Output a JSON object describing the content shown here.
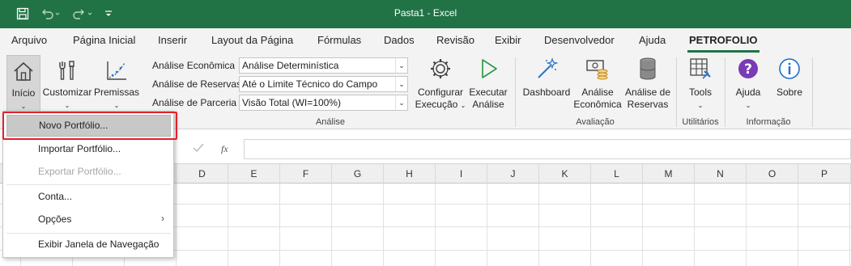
{
  "window": {
    "title": "Pasta1  -  Excel"
  },
  "quick_access": {
    "save_icon": "save-icon",
    "undo_icon": "undo-icon",
    "redo_icon": "redo-icon",
    "customize_icon": "customize-qat-icon"
  },
  "tabs": [
    {
      "label": "Arquivo"
    },
    {
      "label": "Página Inicial"
    },
    {
      "label": "Inserir"
    },
    {
      "label": "Layout da Página"
    },
    {
      "label": "Fórmulas"
    },
    {
      "label": "Dados"
    },
    {
      "label": "Revisão"
    },
    {
      "label": "Exibir"
    },
    {
      "label": "Desenvolvedor"
    },
    {
      "label": "Ajuda"
    },
    {
      "label": "PETROFOLIO"
    }
  ],
  "ribbon": {
    "inicio": {
      "label": "Início"
    },
    "customizar": {
      "label": "Customizar"
    },
    "premissas": {
      "label": "Premissas"
    },
    "fields": {
      "economica_label": "Análise Econômica",
      "economica_value": "Análise Determinística",
      "reservas_label": "Análise de Reservas",
      "reservas_value": "Até o Limite Técnico do Campo",
      "parceria_label": "Análise de Parceria",
      "parceria_value": "Visão Total (WI=100%)"
    },
    "configurar": {
      "line1": "Configurar",
      "line2": "Execução"
    },
    "executar": {
      "line1": "Executar",
      "line2": "Análise"
    },
    "analise_group": "Análise",
    "dashboard": {
      "label": "Dashboard"
    },
    "analise_economica": {
      "line1": "Análise",
      "line2": "Econômica"
    },
    "analise_reservas": {
      "line1": "Análise de",
      "line2": "Reservas"
    },
    "avaliacao_group": "Avaliação",
    "tools": {
      "label": "Tools"
    },
    "utilitarios_group": "Utilitários",
    "ajuda": {
      "label": "Ajuda"
    },
    "sobre": {
      "label": "Sobre"
    },
    "informacao_group": "Informação"
  },
  "formula_bar": {
    "cancel_icon": "cancel-icon",
    "enter_icon": "check-icon",
    "fx_label": "fx",
    "value": ""
  },
  "grid": {
    "columns": [
      "D",
      "E",
      "F",
      "G",
      "H",
      "I",
      "J",
      "K",
      "L",
      "M",
      "N",
      "O",
      "P"
    ]
  },
  "dropdown": {
    "items": [
      {
        "label": "Novo Portfólio...",
        "enabled": true,
        "highlighted": true
      },
      {
        "label": "Importar Portfólio...",
        "enabled": true
      },
      {
        "label": "Exportar Portfólio...",
        "enabled": false
      },
      {
        "label": "Conta...",
        "enabled": true
      },
      {
        "label": "Opções",
        "enabled": true,
        "submenu": true
      },
      {
        "label": "Exibir Janela de Navegação",
        "enabled": true
      }
    ]
  },
  "colors": {
    "excel_green": "#217346",
    "highlight_red": "#e3202a",
    "ajuda_purple": "#7a3bb5",
    "sobre_blue": "#1e6fc9"
  }
}
